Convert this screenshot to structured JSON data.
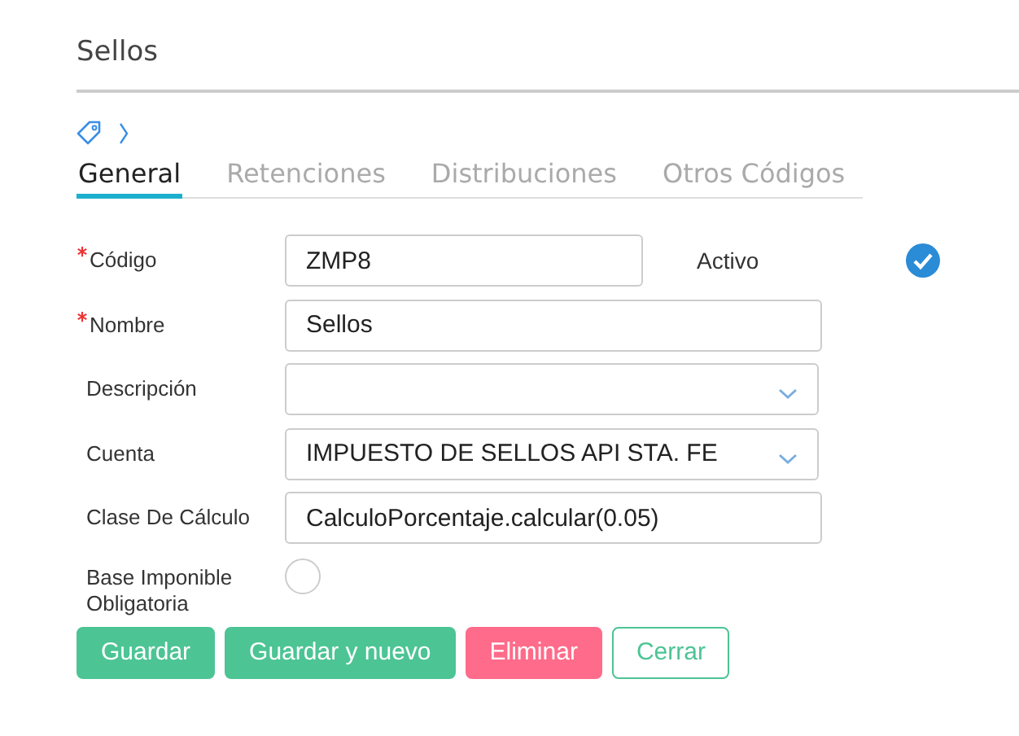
{
  "title": "Sellos",
  "tabs": [
    {
      "label": "General",
      "selected": true
    },
    {
      "label": "Retenciones",
      "selected": false
    },
    {
      "label": "Distribuciones",
      "selected": false
    },
    {
      "label": "Otros Códigos",
      "selected": false
    }
  ],
  "fields": [
    {
      "label": "Código",
      "required": true,
      "kind": "text",
      "value": "ZMP8",
      "side": {
        "label": "Activo",
        "checked": true
      }
    },
    {
      "label": "Nombre",
      "required": true,
      "kind": "text",
      "value": "Sellos"
    },
    {
      "label": "Descripción",
      "required": false,
      "kind": "select"
    },
    {
      "label": "Cuenta",
      "required": false,
      "kind": "select",
      "value": "IMPUESTO DE SELLOS API STA. FE"
    },
    {
      "label": "Clase De Cálculo",
      "required": false,
      "kind": "text",
      "value": "CalculoPorcentaje.calcular(0.05)"
    },
    {
      "label": "Base Imponible Obligatoria",
      "required": false,
      "kind": "toggle",
      "checked": false
    }
  ],
  "buttons": [
    {
      "label": "Guardar",
      "kind": "primary"
    },
    {
      "label": "Guardar y nuevo",
      "kind": "primary"
    },
    {
      "label": "Eliminar",
      "kind": "danger"
    },
    {
      "label": "Cerrar",
      "kind": "outline"
    }
  ]
}
